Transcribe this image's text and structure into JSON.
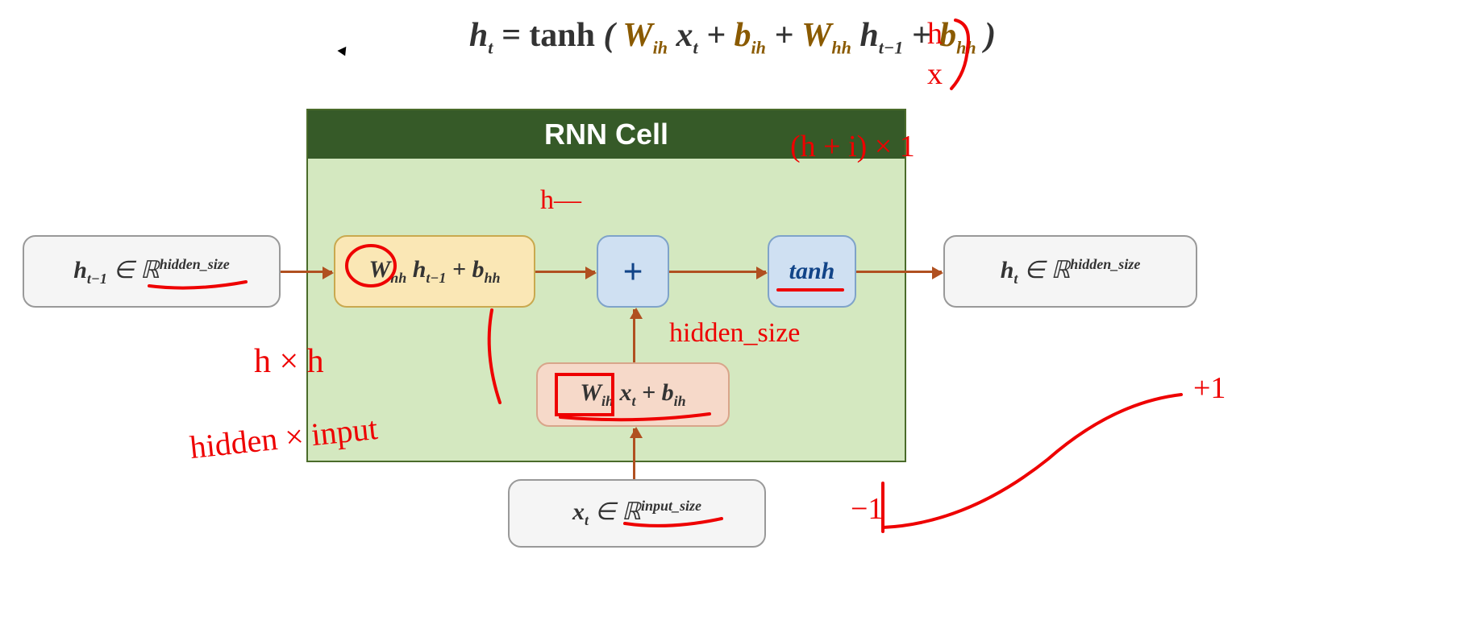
{
  "formula": {
    "lhs": "h",
    "lhs_sub": "t",
    "eq": " = ",
    "tanh": "tanh",
    "open": "(",
    "wih": "W",
    "wih_sub": "ih",
    "xt": "x",
    "xt_sub": "t",
    "plus1": " + ",
    "bih": "b",
    "bih_sub": "ih",
    "plus2": " + ",
    "whh": "W",
    "whh_sub": "hh",
    "ht1": "h",
    "ht1_sub": "t−1",
    "plus3": " + ",
    "bhh": "b",
    "bhh_sub": "hh",
    "close": ")"
  },
  "cell_title": "RNN Cell",
  "nodes": {
    "h_prev": {
      "var": "h",
      "sub": "t−1",
      "in": " ∈ ",
      "set": "ℝ",
      "exp": "hidden_size"
    },
    "whh_block": {
      "w": "W",
      "wsub": "hh",
      "h": "h",
      "hsub": "t−1",
      "plus": " + ",
      "b": "b",
      "bsub": "hh"
    },
    "plus": "+",
    "tanh": "tanh",
    "wih_block": {
      "w": "W",
      "wsub": "ih",
      "x": "x",
      "xsub": "t",
      "plus": " + ",
      "b": "b",
      "bsub": "ih"
    },
    "x_in": {
      "var": "x",
      "sub": "t",
      "in": " ∈ ",
      "set": "ℝ",
      "exp": "input_size"
    },
    "h_out": {
      "var": "h",
      "sub": "t",
      "in": " ∈ ",
      "set": "ℝ",
      "exp": "hidden_size"
    }
  },
  "handwriting": {
    "h_dash": "h—",
    "hidden_size": "hidden_size",
    "h_x_h": "h × h",
    "hidden_x_input": "hidden × input",
    "h_brace": "h",
    "x_brace": "x",
    "hi_x_1": "(h + i) × 1",
    "plus1": "+1",
    "minus1": "−1"
  }
}
